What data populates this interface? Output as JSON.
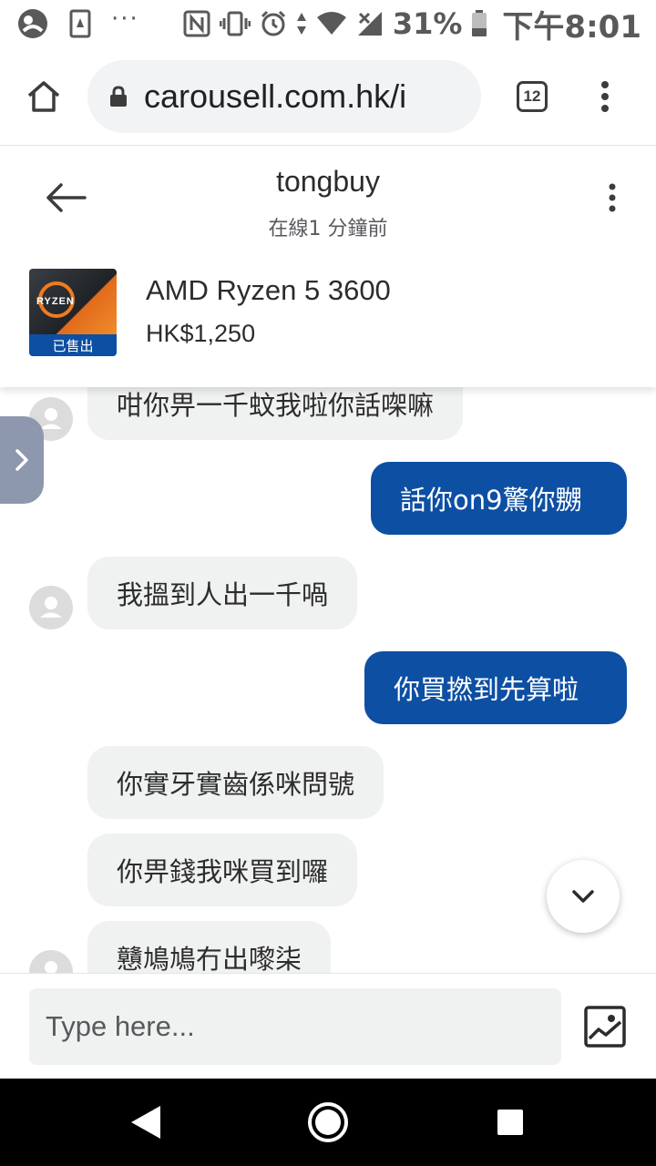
{
  "status_bar": {
    "overflow": "···",
    "battery_percent": "31%",
    "time": "下午8:01",
    "icons": [
      "notification-icon",
      "sim-icon",
      "nfc-icon",
      "vibrate-icon",
      "alarm-icon",
      "data-arrows-icon",
      "wifi-icon",
      "signal-icon",
      "battery-icon"
    ]
  },
  "browser": {
    "url": "carousell.com.hk/i",
    "tab_count": "12"
  },
  "chat": {
    "username": "tongbuy",
    "status": "在線1 分鐘前",
    "listing": {
      "title": "AMD Ryzen 5 3600",
      "price": "HK$1,250",
      "sold_badge": "已售出",
      "thumb_brand": "RYZEN"
    }
  },
  "messages": [
    {
      "direction": "in",
      "text": "咁你畀一千蚊我啦你話㗎嘛"
    },
    {
      "direction": "out",
      "text": "話你on9驚你嬲"
    },
    {
      "direction": "in",
      "text": "我搵到人出一千喎"
    },
    {
      "direction": "out",
      "text": "你買撚到先算啦"
    },
    {
      "direction": "in",
      "text": "你實牙實齒係咪問號"
    },
    {
      "direction": "in",
      "text": "你畀錢我咪買到囉"
    },
    {
      "direction": "in",
      "text": "戇鳩鳩冇出嚟柒"
    }
  ],
  "composer": {
    "placeholder": "Type here..."
  },
  "colors": {
    "brand_blue": "#0d4fa3",
    "incoming_bubble": "#f0f1f1",
    "side_tab": "#8d98ae"
  }
}
